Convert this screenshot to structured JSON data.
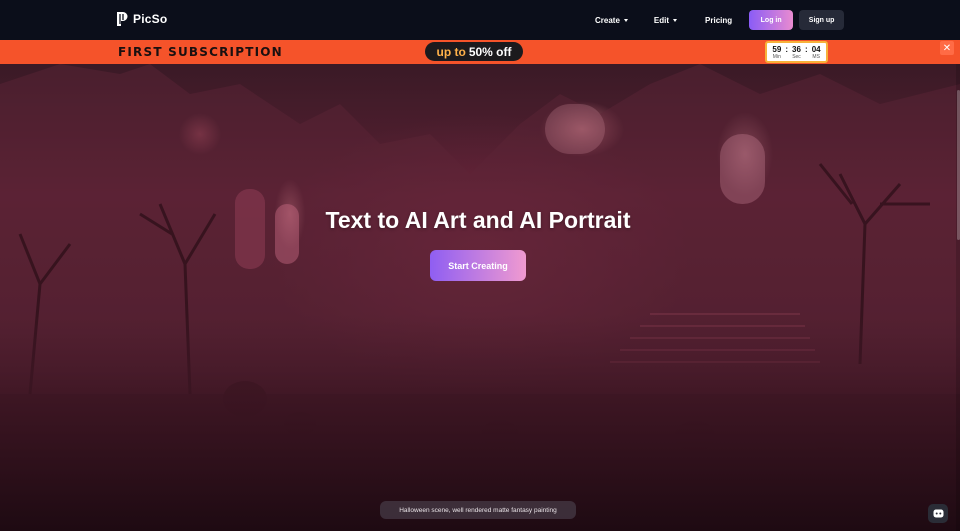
{
  "brand": {
    "name": "PicSo",
    "logo_icon": "picso-logo-icon"
  },
  "nav": {
    "create_label": "Create",
    "edit_label": "Edit",
    "pricing_label": "Pricing",
    "login_label": "Log in",
    "signup_label": "Sign up"
  },
  "promo": {
    "title": "FIRST SUBSCRIPTION",
    "offer_prefix": "up to",
    "offer_value": "50% off",
    "timer": {
      "minutes": "59",
      "minutes_label": "Min",
      "seconds": "36",
      "seconds_label": "Sec",
      "ms": "04",
      "ms_label": "MS"
    },
    "close_icon": "close-icon"
  },
  "hero": {
    "title": "Text to AI Art and AI Portrait",
    "cta_label": "Start Creating",
    "image_caption": "Halloween scene, well rendered matte fantasy painting"
  },
  "colors": {
    "nav_bg": "#0b0e1a",
    "promo_bg": "#f5532a",
    "accent_start": "#8f5ef2",
    "accent_end": "#f09ad0",
    "offer_highlight": "#ffb24a"
  },
  "widgets": {
    "chat_icon": "chat-bot-icon"
  }
}
